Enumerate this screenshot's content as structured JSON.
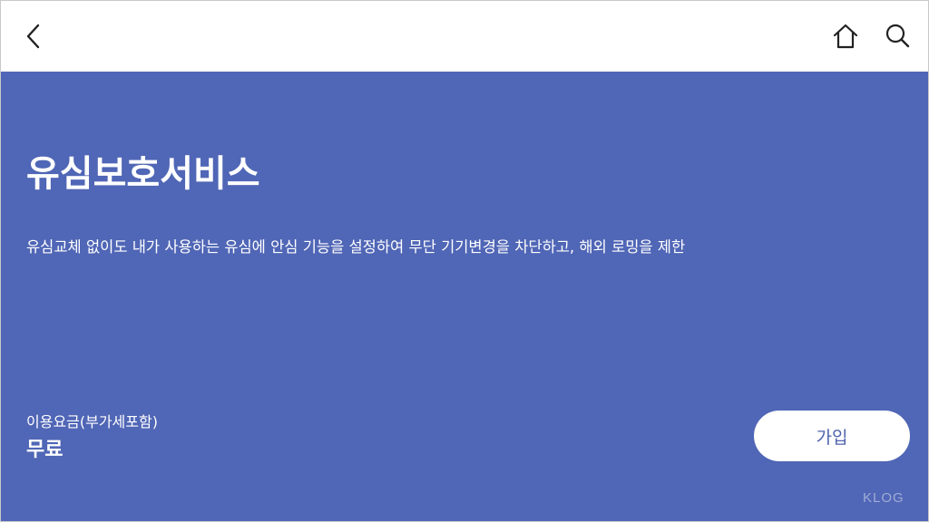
{
  "header": {
    "back_icon": "chevron-left-icon",
    "home_icon": "home-icon",
    "search_icon": "search-icon"
  },
  "hero": {
    "title": "유심보호서비스",
    "description": "유심교체 없이도 내가 사용하는 유심에 안심 기능을 설정하여 무단 기기변경을 차단하고, 해외 로밍을 제한",
    "fee_label": "이용요금(부가세포함)",
    "fee_value": "무료",
    "join_label": "가입",
    "watermark": "KLOG"
  },
  "colors": {
    "hero_background": "#5066b6",
    "button_text": "#4f63ad",
    "top_bar": "#ffffff"
  }
}
